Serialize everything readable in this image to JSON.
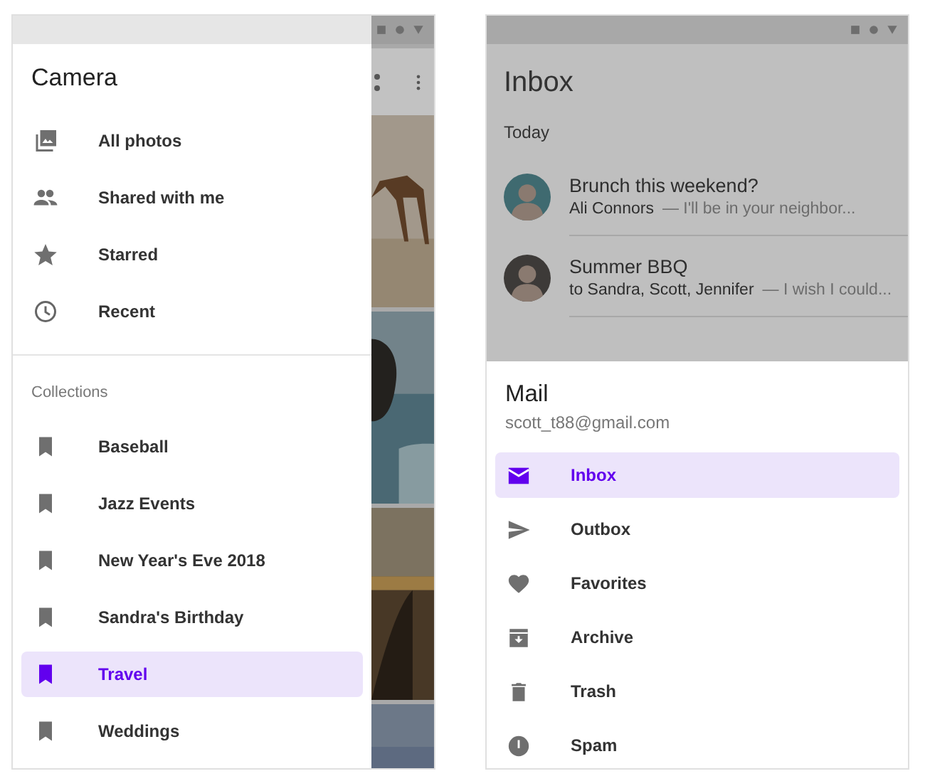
{
  "left": {
    "drawer": {
      "title": "Camera",
      "items": [
        {
          "label": "All photos"
        },
        {
          "label": "Shared with me"
        },
        {
          "label": "Starred"
        },
        {
          "label": "Recent"
        }
      ],
      "section": "Collections",
      "collections": [
        {
          "label": "Baseball",
          "selected": false
        },
        {
          "label": "Jazz Events",
          "selected": false
        },
        {
          "label": "New Year's Eve 2018",
          "selected": false
        },
        {
          "label": "Sandra's Birthday",
          "selected": false
        },
        {
          "label": "Travel",
          "selected": true
        },
        {
          "label": "Weddings",
          "selected": false
        }
      ]
    }
  },
  "right": {
    "inbox": {
      "title": "Inbox",
      "section": "Today",
      "messages": [
        {
          "subject": "Brunch this weekend?",
          "sender": "Ali Connors",
          "preview": "— I'll be in your neighbor..."
        },
        {
          "subject": "Summer BBQ",
          "sender": "to Sandra, Scott, Jennifer",
          "preview": "— I wish I could..."
        }
      ]
    },
    "sheet": {
      "title": "Mail",
      "email": "scott_t88@gmail.com",
      "items": [
        {
          "label": "Inbox",
          "selected": true
        },
        {
          "label": "Outbox",
          "selected": false
        },
        {
          "label": "Favorites",
          "selected": false
        },
        {
          "label": "Archive",
          "selected": false
        },
        {
          "label": "Trash",
          "selected": false
        },
        {
          "label": "Spam",
          "selected": false
        }
      ]
    }
  }
}
